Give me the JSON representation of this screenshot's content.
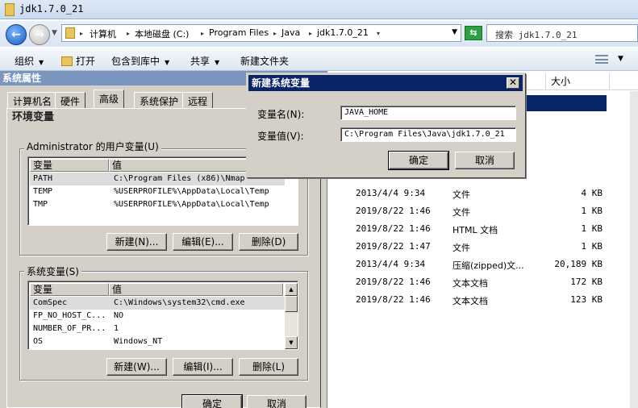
{
  "window": {
    "title": "jdk1.7.0_21"
  },
  "address": {
    "crumbs": [
      "计算机",
      "本地磁盘 (C:)",
      "Program Files",
      "Java",
      "jdk1.7.0_21"
    ],
    "search_placeholder": "搜索 jdk1.7.0_21"
  },
  "toolbar": {
    "organize": "组织",
    "open": "打开",
    "include_in_library": "包含到库中",
    "share": "共享",
    "new_folder": "新建文件夹"
  },
  "filelist": {
    "size_header": "大小",
    "rows": [
      {
        "date": "2013/4/4 9:34",
        "type": "文件",
        "size": "4 KB"
      },
      {
        "date": "2019/8/22 1:46",
        "type": "文件",
        "size": "1 KB"
      },
      {
        "date": "2019/8/22 1:46",
        "type": "HTML 文档",
        "size": "1 KB"
      },
      {
        "date": "2019/8/22 1:47",
        "type": "文件",
        "size": "1 KB"
      },
      {
        "date": "2013/4/4 9:34",
        "type": "压缩(zipped)文...",
        "size": "20,189 KB"
      },
      {
        "date": "2019/8/22 1:46",
        "type": "文本文档",
        "size": "172 KB"
      },
      {
        "date": "2019/8/22 1:46",
        "type": "文本文档",
        "size": "123 KB"
      }
    ]
  },
  "sysprops": {
    "title": "系统属性",
    "tabs": [
      "计算机名",
      "硬件",
      "高级",
      "系统保护",
      "远程"
    ],
    "env_title": "环境变量",
    "user_group_label": "Administrator 的用户变量(U)",
    "user_columns": [
      "变量",
      "值"
    ],
    "user_vars": [
      {
        "name": "PATH",
        "value": "C:\\Program Files (x86)\\Nmap"
      },
      {
        "name": "TEMP",
        "value": "%USERPROFILE%\\AppData\\Local\\Temp"
      },
      {
        "name": "TMP",
        "value": "%USERPROFILE%\\AppData\\Local\\Temp"
      }
    ],
    "user_buttons": {
      "new": "新建(N)...",
      "edit": "编辑(E)...",
      "delete": "删除(D)"
    },
    "system_group_label": "系统变量(S)",
    "system_columns": [
      "变量",
      "值"
    ],
    "system_vars": [
      {
        "name": "ComSpec",
        "value": "C:\\Windows\\system32\\cmd.exe"
      },
      {
        "name": "FP_NO_HOST_C...",
        "value": "NO"
      },
      {
        "name": "NUMBER_OF_PR...",
        "value": "1"
      },
      {
        "name": "OS",
        "value": "Windows_NT"
      }
    ],
    "system_buttons": {
      "new": "新建(W)...",
      "edit": "编辑(I)...",
      "delete": "删除(L)"
    },
    "ok": "确定",
    "cancel": "取消"
  },
  "new_var_dialog": {
    "title": "新建系统变量",
    "name_label": "变量名(N):",
    "name_value": "JAVA_HOME",
    "value_label": "变量值(V):",
    "value_value": "C:\\Program Files\\Java\\jdk1.7.0_21",
    "ok": "确定",
    "cancel": "取消"
  }
}
